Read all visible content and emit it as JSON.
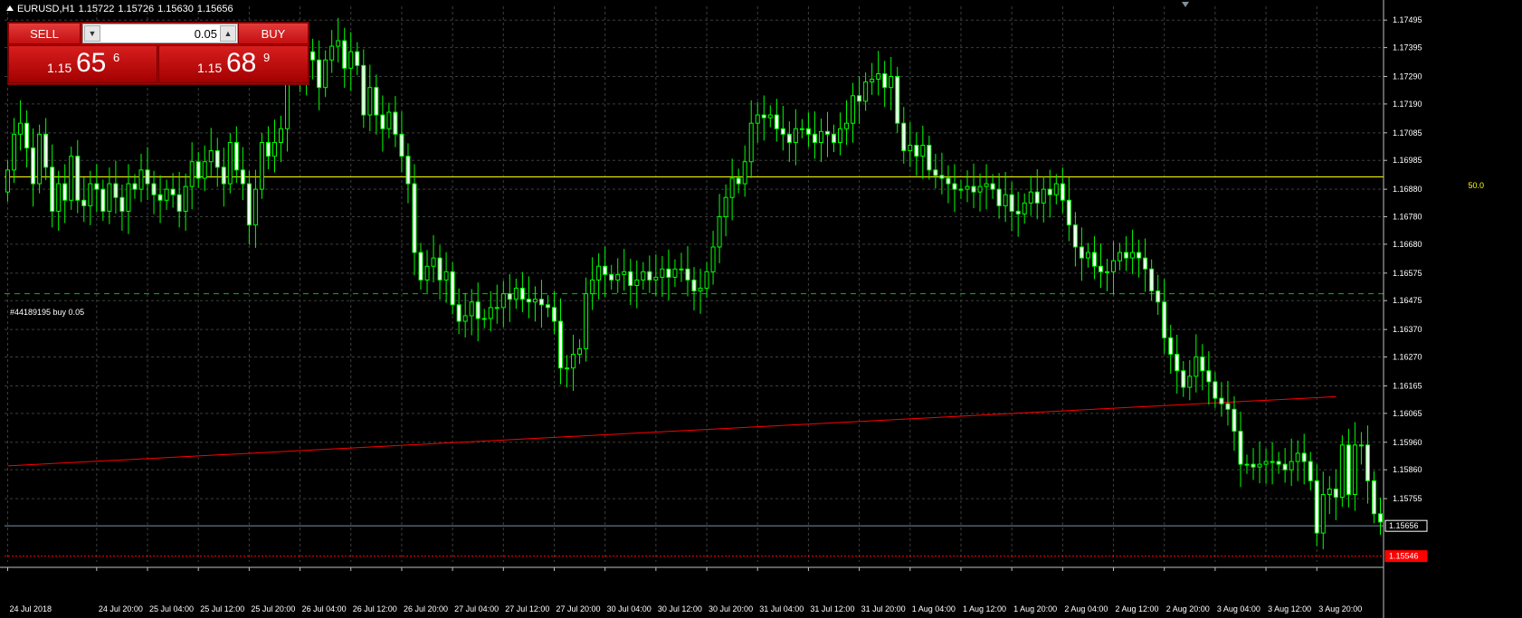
{
  "header": {
    "symbol": "EURUSD,H1",
    "open": "1.15722",
    "high": "1.15726",
    "low": "1.15630",
    "close": "1.15656"
  },
  "trade_panel": {
    "sell_label": "SELL",
    "buy_label": "BUY",
    "volume": "0.05",
    "bid_small": "1.15",
    "bid_big": "65",
    "bid_sup": "6",
    "ask_small": "1.15",
    "ask_big": "68",
    "ask_sup": "9"
  },
  "order_label": "#44189195 buy 0.05",
  "level_label": "50.0",
  "colors": {
    "background": "#000000",
    "grid": "#3b3f3b",
    "candle": "#00ff00",
    "bull_body": "#000000",
    "bear_body": "#ffffff",
    "trend": "#ff0000",
    "level": "#ffff00",
    "order": "#00c000",
    "price_line": "#7f8fa6"
  },
  "chart_data": {
    "type": "candlestick",
    "ylim": [
      1.15525,
      1.17545
    ],
    "yticks": [
      "1.17495",
      "1.17395",
      "1.17290",
      "1.17190",
      "1.17085",
      "1.16985",
      "1.16880",
      "1.16780",
      "1.16680",
      "1.16575",
      "1.16475",
      "1.16370",
      "1.16270",
      "1.16165",
      "1.16065",
      "1.15960",
      "1.15860",
      "1.15755"
    ],
    "xticks": [
      {
        "label": "24 Jul 2018",
        "index": 0
      },
      {
        "label": "24 Jul 20:00",
        "index": 14
      },
      {
        "label": "25 Jul 04:00",
        "index": 22
      },
      {
        "label": "25 Jul 12:00",
        "index": 30
      },
      {
        "label": "25 Jul 20:00",
        "index": 38
      },
      {
        "label": "26 Jul 04:00",
        "index": 46
      },
      {
        "label": "26 Jul 12:00",
        "index": 54
      },
      {
        "label": "26 Jul 20:00",
        "index": 62
      },
      {
        "label": "27 Jul 04:00",
        "index": 70
      },
      {
        "label": "27 Jul 12:00",
        "index": 78
      },
      {
        "label": "27 Jul 20:00",
        "index": 86
      },
      {
        "label": "30 Jul 04:00",
        "index": 94
      },
      {
        "label": "30 Jul 12:00",
        "index": 102
      },
      {
        "label": "30 Jul 20:00",
        "index": 110
      },
      {
        "label": "31 Jul 04:00",
        "index": 118
      },
      {
        "label": "31 Jul 12:00",
        "index": 126
      },
      {
        "label": "31 Jul 20:00",
        "index": 134
      },
      {
        "label": "1 Aug 04:00",
        "index": 142
      },
      {
        "label": "1 Aug 12:00",
        "index": 150
      },
      {
        "label": "1 Aug 20:00",
        "index": 158
      },
      {
        "label": "2 Aug 04:00",
        "index": 166
      },
      {
        "label": "2 Aug 12:00",
        "index": 174
      },
      {
        "label": "2 Aug 20:00",
        "index": 182
      },
      {
        "label": "3 Aug 04:00",
        "index": 190
      },
      {
        "label": "3 Aug 12:00",
        "index": 198
      },
      {
        "label": "3 Aug 20:00",
        "index": 206
      }
    ],
    "closes": [
      1.1695,
      1.1708,
      1.1712,
      1.1703,
      1.169,
      1.1708,
      1.1696,
      1.168,
      1.169,
      1.1684,
      1.17,
      1.1684,
      1.1682,
      1.169,
      1.1688,
      1.168,
      1.169,
      1.1685,
      1.168,
      1.169,
      1.1688,
      1.1695,
      1.169,
      1.1686,
      1.1684,
      1.1688,
      1.1686,
      1.168,
      1.1689,
      1.1698,
      1.1692,
      1.1698,
      1.1702,
      1.1696,
      1.169,
      1.1705,
      1.1695,
      1.169,
      1.1675,
      1.1688,
      1.1705,
      1.17,
      1.1705,
      1.171,
      1.1735,
      1.174,
      1.1728,
      1.1738,
      1.1735,
      1.1725,
      1.1735,
      1.174,
      1.1742,
      1.1732,
      1.1738,
      1.1733,
      1.1715,
      1.1725,
      1.1715,
      1.171,
      1.1716,
      1.1708,
      1.17,
      1.169,
      1.1665,
      1.1655,
      1.166,
      1.1663,
      1.1655,
      1.1658,
      1.1646,
      1.164,
      1.1642,
      1.1647,
      1.1641,
      1.1641,
      1.1645,
      1.1645,
      1.165,
      1.1648,
      1.1652,
      1.1648,
      1.1647,
      1.1648,
      1.1646,
      1.1645,
      1.164,
      1.1623,
      1.1623,
      1.1628,
      1.163,
      1.165,
      1.1655,
      1.166,
      1.1657,
      1.1655,
      1.1657,
      1.1658,
      1.1653,
      1.1655,
      1.1658,
      1.1655,
      1.1656,
      1.1659,
      1.1656,
      1.1659,
      1.1659,
      1.1655,
      1.1651,
      1.1652,
      1.1658,
      1.1667,
      1.1678,
      1.1685,
      1.1692,
      1.169,
      1.1698,
      1.1712,
      1.1715,
      1.1714,
      1.1715,
      1.171,
      1.1708,
      1.1705,
      1.171,
      1.171,
      1.1708,
      1.1705,
      1.1709,
      1.1708,
      1.1705,
      1.171,
      1.1712,
      1.1722,
      1.172,
      1.1727,
      1.1728,
      1.173,
      1.1725,
      1.1729,
      1.1712,
      1.1702,
      1.1704,
      1.17,
      1.1704,
      1.1695,
      1.1693,
      1.1692,
      1.169,
      1.1688,
      1.1688,
      1.1689,
      1.1687,
      1.1689,
      1.169,
      1.1688,
      1.1682,
      1.1686,
      1.168,
      1.1679,
      1.1683,
      1.1687,
      1.1683,
      1.1688,
      1.1686,
      1.169,
      1.1684,
      1.1675,
      1.1667,
      1.1663,
      1.1665,
      1.166,
      1.1658,
      1.1658,
      1.1662,
      1.1665,
      1.1663,
      1.1665,
      1.1663,
      1.1659,
      1.1651,
      1.1647,
      1.1634,
      1.1628,
      1.1622,
      1.1616,
      1.162,
      1.1627,
      1.1622,
      1.1618,
      1.1612,
      1.161,
      1.1608,
      1.16,
      1.1588,
      1.1588,
      1.1587,
      1.1588,
      1.1589,
      1.1589,
      1.1588,
      1.1586,
      1.1589,
      1.1592,
      1.1589,
      1.1582,
      1.1563,
      1.1577,
      1.1579,
      1.1576,
      1.1595,
      1.1577,
      1.1595,
      1.1595,
      1.1582,
      1.157,
      1.1567
    ],
    "trendline": {
      "from": {
        "index": 0,
        "price": 1.15874
      },
      "to": {
        "index": 209,
        "price": 1.16126
      }
    },
    "horizontal_levels": [
      {
        "name": "level-50",
        "price": 1.16925,
        "label": "50.0"
      },
      {
        "name": "order-line",
        "price": 1.165,
        "label": "#44189195 buy 0.05"
      },
      {
        "name": "bid-line",
        "price": 1.15656,
        "label": "1.15656"
      },
      {
        "name": "ask-line",
        "price": 1.15546,
        "label": "1.15546"
      }
    ]
  }
}
